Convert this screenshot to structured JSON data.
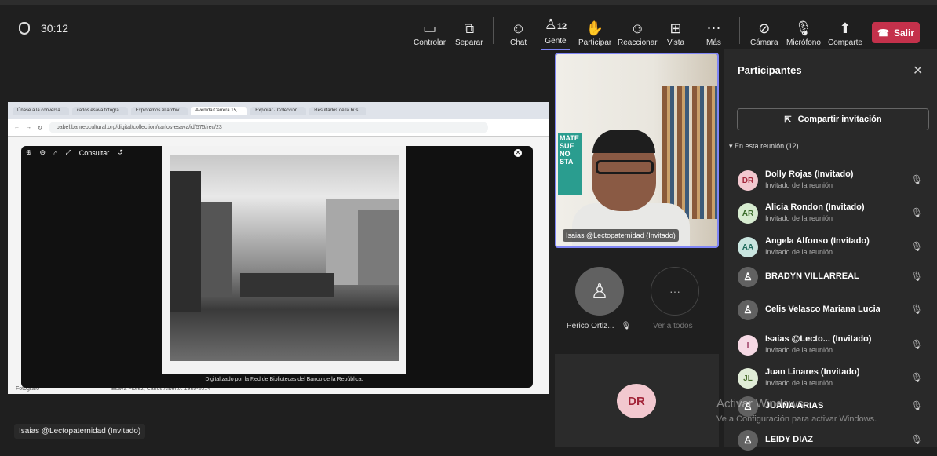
{
  "timer": "30:12",
  "toolbar": {
    "controlar": "Controlar",
    "separar": "Separar",
    "chat": "Chat",
    "gente": "Gente",
    "gente_count": "12",
    "participar": "Participar",
    "reaccionar": "Reaccionar",
    "vista": "Vista",
    "mas": "Más",
    "camara": "Cámara",
    "microfono": "Micrófono",
    "compartir": "Comparte",
    "salir": "Salir"
  },
  "browser": {
    "tabs": [
      "Únase a la conversa...",
      "carlos esava fotogra...",
      "Exploremos el archiv...",
      "Avenida Carrera 15, ...",
      "Explorar - Coleccion...",
      "Resultados de la bús..."
    ],
    "url": "babel.banrepcultural.org/digital/collection/carlos-esava/id/575/rec/23"
  },
  "viewer": {
    "consultar": "Consultar",
    "caption": "Digitalizado por la Red de Bibliotecas del Banco de la República.",
    "bg_label": "Fotógrafo",
    "bg_value": "Esava Flórez, Carlos Alberto. 1935-2014"
  },
  "presenter_label": "Isaias @Lectopaternidad (Invitado)",
  "video_tile_name": "Isaias @Lectopaternidad (Invitado)",
  "mini_tiles": {
    "perico": "Perico Ortiz...",
    "ver_todos": "Ver a todos"
  },
  "dr_tile_initials": "DR",
  "panel": {
    "title": "Participantes",
    "invite": "Compartir invitación",
    "section": "En esta reunión (12)",
    "participants": [
      {
        "initials": "DR",
        "name": "Dolly Rojas (Invitado)",
        "sub": "Invitado de la reunión",
        "bg": "#f2c8cf",
        "fg": "#a3263a"
      },
      {
        "initials": "AR",
        "name": "Alicia Rondon (Invitado)",
        "sub": "Invitado de la reunión",
        "bg": "#d7ecd0",
        "fg": "#3a6b2a"
      },
      {
        "initials": "AA",
        "name": "Angela Alfonso (Invitado)",
        "sub": "Invitado de la reunión",
        "bg": "#c9e5df",
        "fg": "#1f6b5c"
      },
      {
        "initials": "",
        "name": "BRADYN VILLARREAL",
        "sub": "",
        "bg": "#616161",
        "fg": "#fff"
      },
      {
        "initials": "",
        "name": "Celis Velasco Mariana Lucia",
        "sub": "",
        "bg": "#616161",
        "fg": "#fff"
      },
      {
        "initials": "I",
        "name": "Isaias @Lecto...  (Invitado)",
        "sub": "Invitado de la reunión",
        "bg": "#f6d9e4",
        "fg": "#9b3b63"
      },
      {
        "initials": "JL",
        "name": "Juan Linares (Invitado)",
        "sub": "Invitado de la reunión",
        "bg": "#e0ecd7",
        "fg": "#466b2a"
      },
      {
        "initials": "",
        "name": "JUANA ARIAS",
        "sub": "",
        "bg": "#616161",
        "fg": "#fff"
      },
      {
        "initials": "",
        "name": "LEIDY DIAZ",
        "sub": "",
        "bg": "#616161",
        "fg": "#fff"
      }
    ]
  },
  "watermark": {
    "line1": "Activar Windows",
    "line2": "Ve a Configuración para activar Windows."
  }
}
